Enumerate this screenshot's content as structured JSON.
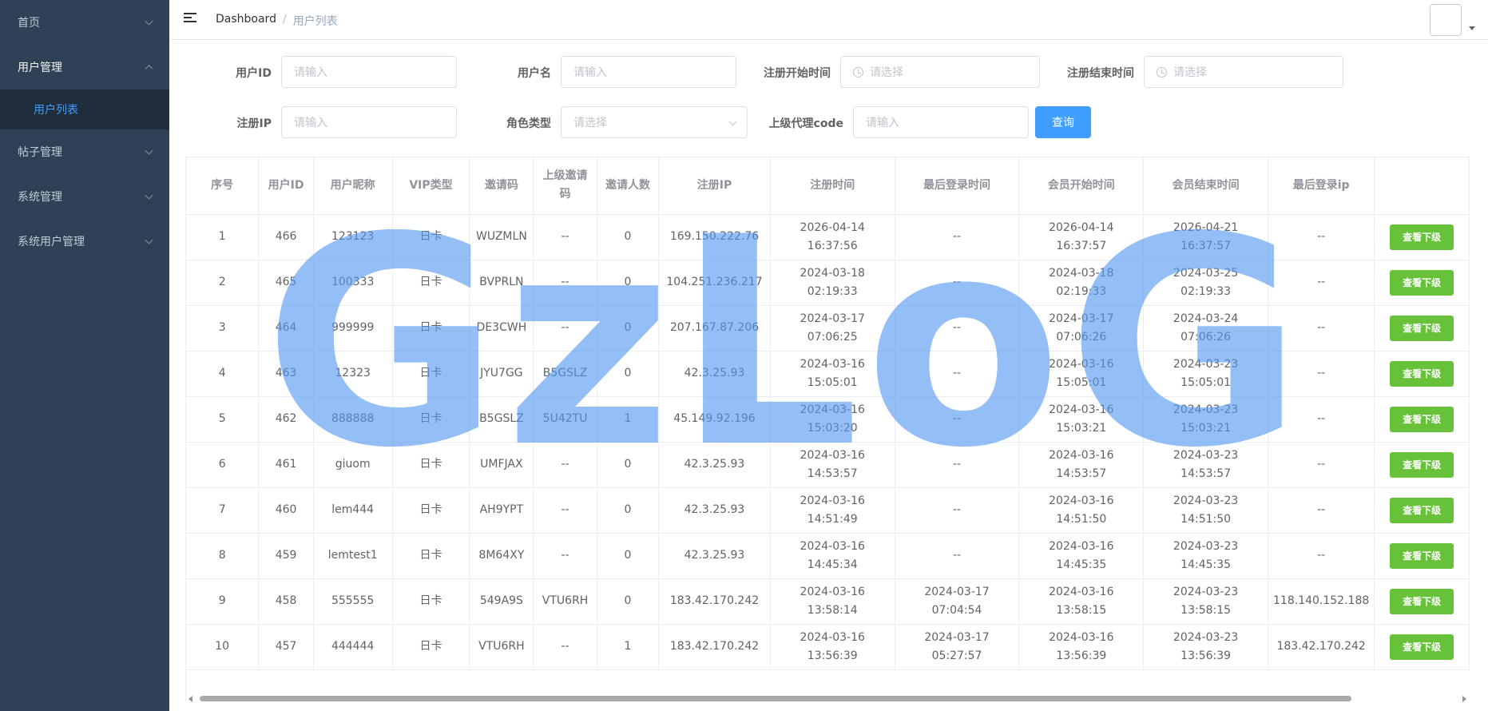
{
  "sidebar": {
    "items": [
      {
        "label": "首页"
      },
      {
        "label": "用户管理",
        "sub": "用户列表"
      },
      {
        "label": "帖子管理"
      },
      {
        "label": "系统管理"
      },
      {
        "label": "系统用户管理"
      }
    ]
  },
  "breadcrumb": {
    "home": "Dashboard",
    "sep": "/",
    "current": "用户列表"
  },
  "search": {
    "user_id": {
      "label": "用户ID",
      "placeholder": "请输入"
    },
    "username": {
      "label": "用户名",
      "placeholder": "请输入"
    },
    "reg_start": {
      "label": "注册开始时间",
      "placeholder": "请选择"
    },
    "reg_end": {
      "label": "注册结束时间",
      "placeholder": "请选择"
    },
    "reg_ip": {
      "label": "注册IP",
      "placeholder": "请输入"
    },
    "role": {
      "label": "角色类型",
      "placeholder": "请选择"
    },
    "agent": {
      "label": "上级代理code",
      "placeholder": "请输入"
    },
    "query_label": "查询"
  },
  "table": {
    "headers": [
      "序号",
      "用户ID",
      "用户昵称",
      "VIP类型",
      "邀请码",
      "上级邀请码",
      "邀请人数",
      "注册IP",
      "注册时间",
      "最后登录时间",
      "会员开始时间",
      "会员结束时间",
      "最后登录ip",
      ""
    ],
    "action_label": "查看下级",
    "rows": [
      [
        "1",
        "466",
        "123123",
        "日卡",
        "WUZMLN",
        "--",
        "0",
        "169.150.222.76",
        "2026-04-14 16:37:56",
        "--",
        "2026-04-14 16:37:57",
        "2026-04-21 16:37:57",
        "--"
      ],
      [
        "2",
        "465",
        "100333",
        "日卡",
        "BVPRLN",
        "--",
        "0",
        "104.251.236.217",
        "2024-03-18 02:19:33",
        "--",
        "2024-03-18 02:19:33",
        "2024-03-25 02:19:33",
        "--"
      ],
      [
        "3",
        "464",
        "999999",
        "日卡",
        "DE3CWH",
        "--",
        "0",
        "207.167.87.206",
        "2024-03-17 07:06:25",
        "--",
        "2024-03-17 07:06:26",
        "2024-03-24 07:06:26",
        "--"
      ],
      [
        "4",
        "463",
        "12323",
        "日卡",
        "JYU7GG",
        "B5GSLZ",
        "0",
        "42.3.25.93",
        "2024-03-16 15:05:01",
        "--",
        "2024-03-16 15:05:01",
        "2024-03-23 15:05:01",
        "--"
      ],
      [
        "5",
        "462",
        "888888",
        "日卡",
        "B5GSLZ",
        "5U42TU",
        "1",
        "45.149.92.196",
        "2024-03-16 15:03:20",
        "--",
        "2024-03-16 15:03:21",
        "2024-03-23 15:03:21",
        "--"
      ],
      [
        "6",
        "461",
        "giuom",
        "日卡",
        "UMFJAX",
        "--",
        "0",
        "42.3.25.93",
        "2024-03-16 14:53:57",
        "--",
        "2024-03-16 14:53:57",
        "2024-03-23 14:53:57",
        "--"
      ],
      [
        "7",
        "460",
        "lem444",
        "日卡",
        "AH9YPT",
        "--",
        "0",
        "42.3.25.93",
        "2024-03-16 14:51:49",
        "--",
        "2024-03-16 14:51:50",
        "2024-03-23 14:51:50",
        "--"
      ],
      [
        "8",
        "459",
        "lemtest1",
        "日卡",
        "8M64XY",
        "--",
        "0",
        "42.3.25.93",
        "2024-03-16 14:45:34",
        "--",
        "2024-03-16 14:45:35",
        "2024-03-23 14:45:35",
        "--"
      ],
      [
        "9",
        "458",
        "555555",
        "日卡",
        "549A9S",
        "VTU6RH",
        "0",
        "183.42.170.242",
        "2024-03-16 13:58:14",
        "2024-03-17 07:04:54",
        "2024-03-16 13:58:15",
        "2024-03-23 13:58:15",
        "118.140.152.188"
      ],
      [
        "10",
        "457",
        "444444",
        "日卡",
        "VTU6RH",
        "--",
        "1",
        "183.42.170.242",
        "2024-03-16 13:56:39",
        "2024-03-17 05:27:57",
        "2024-03-16 13:56:39",
        "2024-03-23 13:56:39",
        "183.42.170.242"
      ]
    ]
  },
  "watermark": "GzLoG"
}
